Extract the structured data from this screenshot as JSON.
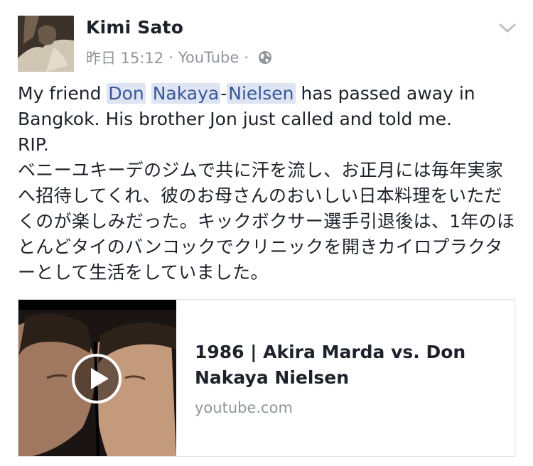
{
  "post": {
    "author": "Kimi Sato",
    "timestamp": "昨日 15:12",
    "separator": "·",
    "via": "YouTube",
    "audience_icon": "globe-icon",
    "menu_icon": "chevron-down-icon",
    "text_line1_prefix": "My friend ",
    "mention_first": "Don",
    "mention_space": " ",
    "mention_second": "Nakaya",
    "mention_hyphen": "-",
    "mention_third": "Nielsen",
    "text_line1_suffix": " has passed away in",
    "text_line2": "Bangkok.  His brother Jon just called and told me.",
    "text_line3": "RIP.",
    "text_jp": "ベニーユキーデのジムで共に汗を流し、お正月には毎年実家へ招待してくれ、彼のお母さんのおいしい日本料理をいただくのが楽しみだった。キックボクサー選手引退後は、1年のほとんどタイのバンコックでクリニックを開きカイロプラクターとして生活をしていました。"
  },
  "link_card": {
    "title": "1986 | Akira Marda vs. Don Nakaya Nielsen",
    "domain": "youtube.com",
    "play_icon": "play-icon"
  },
  "colors": {
    "text": "#1d2129",
    "meta": "#90949c",
    "mention_bg": "#dfe4f2",
    "mention_text": "#365899",
    "border": "#dddfe2"
  }
}
